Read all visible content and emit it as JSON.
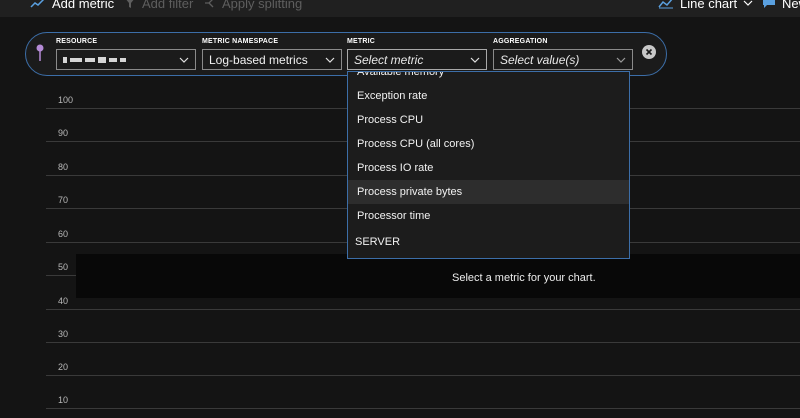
{
  "toolbar": {
    "add_metric": "Add metric",
    "add_filter": "Add filter",
    "apply_splitting": "Apply splitting",
    "chart_type": "Line chart",
    "new": "New"
  },
  "metric_row": {
    "resource": {
      "label": "RESOURCE",
      "value_redacted": true
    },
    "namespace": {
      "label": "METRIC NAMESPACE",
      "value": "Log-based metrics"
    },
    "metric": {
      "label": "METRIC",
      "placeholder": "Select metric"
    },
    "aggregation": {
      "label": "AGGREGATION",
      "placeholder": "Select value(s)"
    }
  },
  "dropdown": {
    "items": [
      "Available memory",
      "Exception rate",
      "Process CPU",
      "Process CPU (all cores)",
      "Process IO rate",
      "Process private bytes",
      "Processor time",
      "SERVER"
    ],
    "hovered": "Process private bytes"
  },
  "chart": {
    "y_ticks": [
      "100",
      "90",
      "80",
      "70",
      "60",
      "50",
      "40",
      "30",
      "20",
      "10"
    ],
    "empty_message": "Select a metric for your chart."
  },
  "colors": {
    "background": "#141414",
    "accent_border": "#3c6ea8",
    "toolbar_bg": "#202020",
    "chart_icon": "#5aa0e0",
    "pin_icon": "#b58bd6"
  }
}
